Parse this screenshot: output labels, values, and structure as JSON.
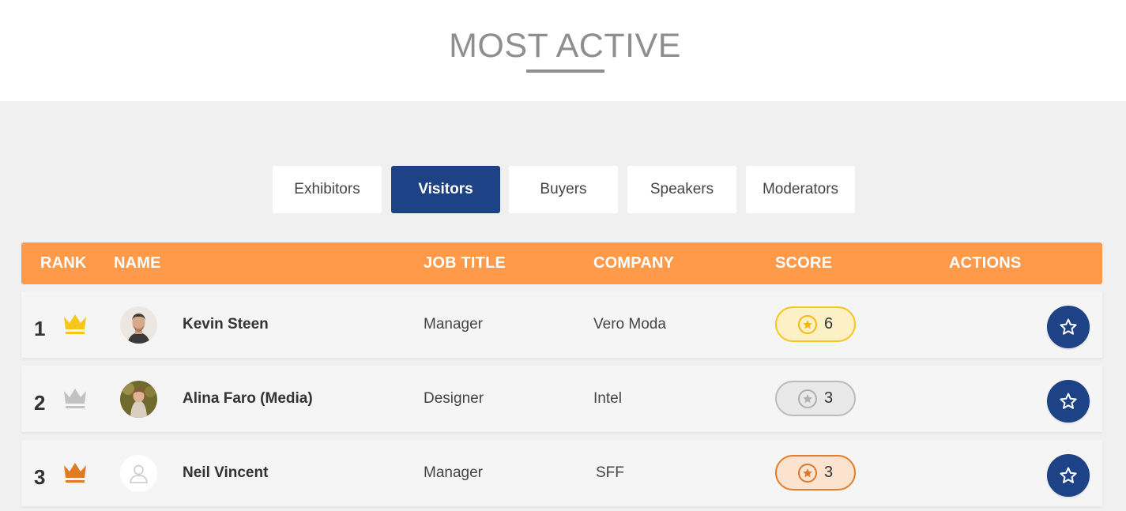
{
  "header": {
    "title": "MOST ACTIVE"
  },
  "tabs": [
    {
      "label": "Exhibitors",
      "active": false
    },
    {
      "label": "Visitors",
      "active": true
    },
    {
      "label": "Buyers",
      "active": false
    },
    {
      "label": "Speakers",
      "active": false
    },
    {
      "label": "Moderators",
      "active": false
    }
  ],
  "table": {
    "columns": {
      "rank": "RANK",
      "name": "NAME",
      "job": "JOB TITLE",
      "company": "COMPANY",
      "score": "SCORE",
      "actions": "ACTIONS"
    },
    "rows": [
      {
        "rank": "1",
        "name": "Kevin Steen",
        "job": "Manager",
        "company": "Vero Moda",
        "score": "6",
        "tier": "gold"
      },
      {
        "rank": "2",
        "name": "Alina Faro (Media)",
        "job": "Designer",
        "company": "Intel",
        "score": "3",
        "tier": "silver"
      },
      {
        "rank": "3",
        "name": "Neil Vincent",
        "job": "Manager",
        "company": "SFF",
        "score": "3",
        "tier": "bronze"
      }
    ]
  },
  "colors": {
    "accent_orange": "#ff9a4a",
    "brand_blue": "#1d4386",
    "gold": "#f6c61f",
    "silver": "#bcbcbc",
    "bronze": "#e47e2b"
  },
  "icons": {
    "crown": "crown-icon",
    "star": "star-icon",
    "action": "star-outline-icon",
    "placeholder_avatar": "user-silhouette-icon"
  }
}
